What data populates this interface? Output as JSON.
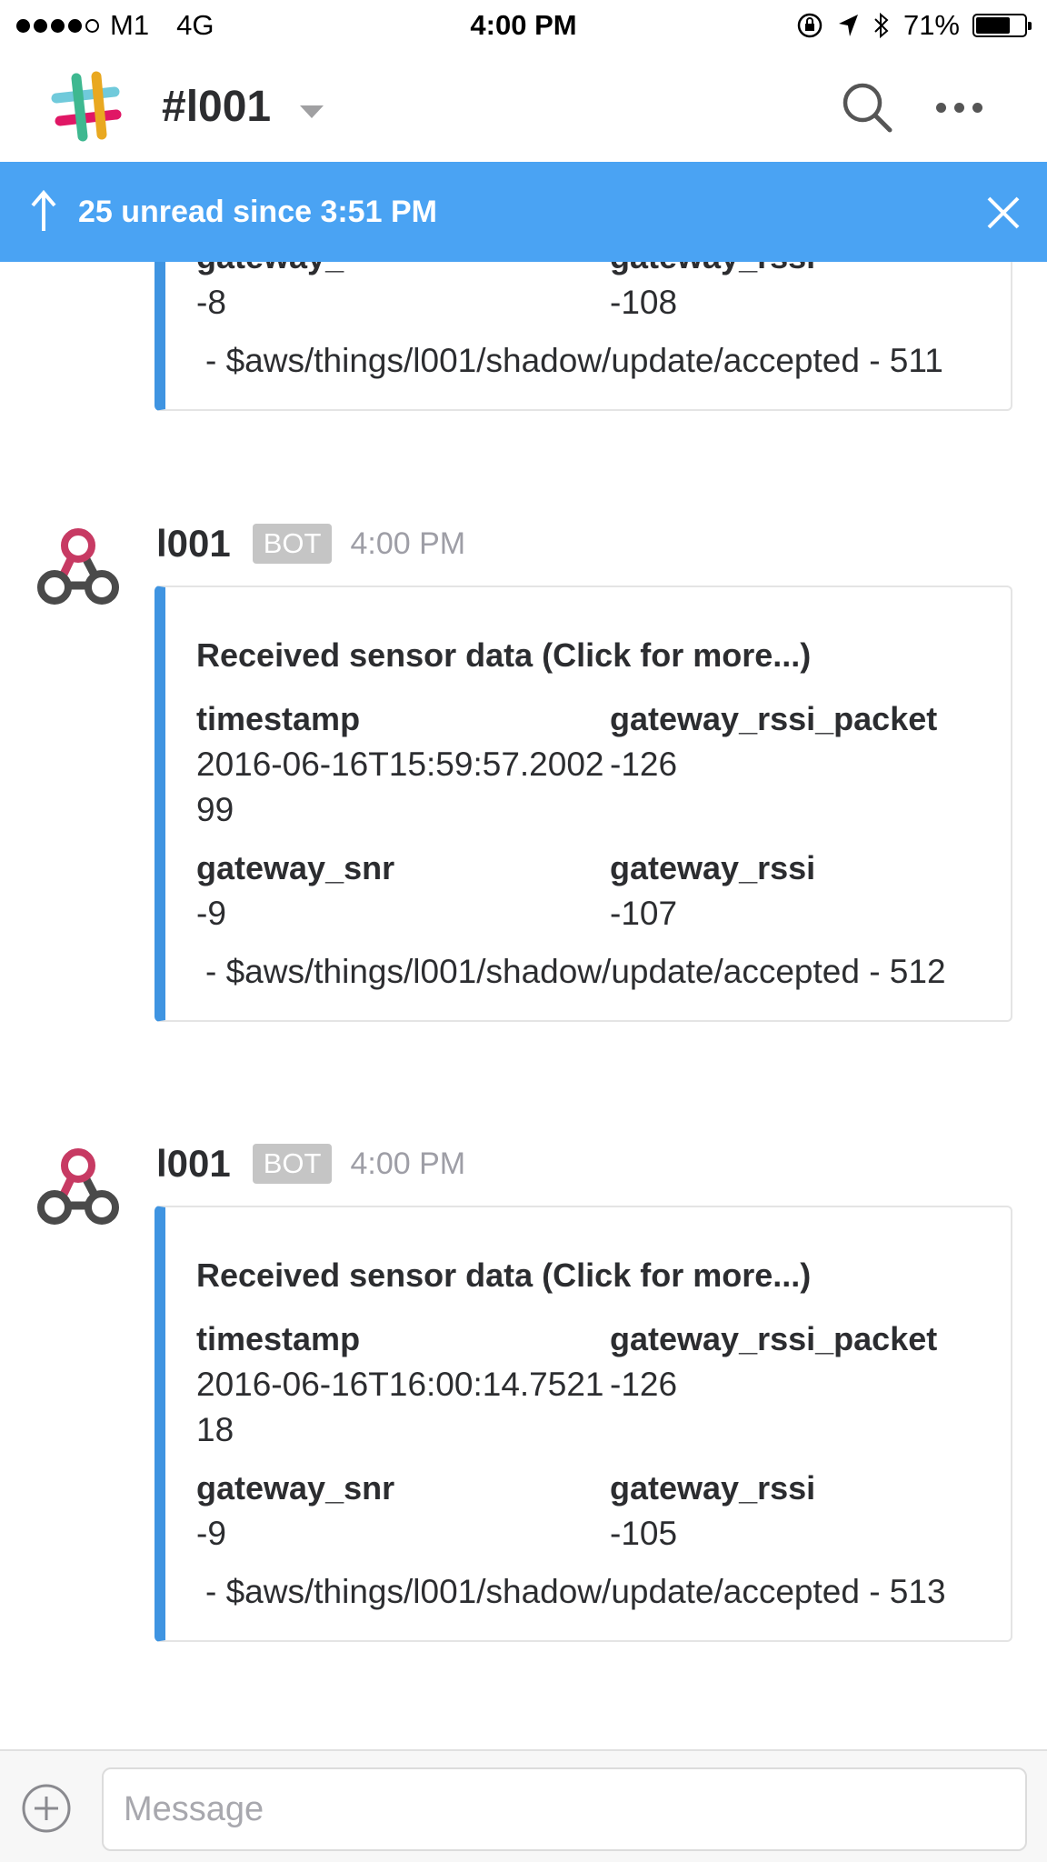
{
  "status_bar": {
    "carrier": "M1",
    "network": "4G",
    "time": "4:00 PM",
    "battery": "71%",
    "battery_level": 0.71
  },
  "header": {
    "channel": "#l001"
  },
  "banner": {
    "text": "25 unread since 3:51 PM"
  },
  "partial_attachment": {
    "label_left": "gateway_",
    "label_right": "gateway_rssi",
    "value_left": "-8",
    "value_right": "-108",
    "footer": "- $aws/things/l001/shadow/update/accepted - 511"
  },
  "messages": [
    {
      "user": "l001",
      "badge": "BOT",
      "time": "4:00 PM",
      "title": "Received sensor data (Click for more...)",
      "fields": [
        {
          "label": "timestamp",
          "value": "2016-06-16T15:59:57.200299"
        },
        {
          "label": "gateway_rssi_packet",
          "value": "-126"
        },
        {
          "label": "gateway_snr",
          "value": "-9"
        },
        {
          "label": "gateway_rssi",
          "value": "-107"
        }
      ],
      "footer": "- $aws/things/l001/shadow/update/accepted - 512"
    },
    {
      "user": "l001",
      "badge": "BOT",
      "time": "4:00 PM",
      "title": "Received sensor data (Click for more...)",
      "fields": [
        {
          "label": "timestamp",
          "value": "2016-06-16T16:00:14.752118"
        },
        {
          "label": "gateway_rssi_packet",
          "value": "-126"
        },
        {
          "label": "gateway_snr",
          "value": "-9"
        },
        {
          "label": "gateway_rssi",
          "value": "-105"
        }
      ],
      "footer": "- $aws/things/l001/shadow/update/accepted - 513"
    }
  ],
  "composer": {
    "placeholder": "Message"
  },
  "colors": {
    "banner": "#4aa3f3",
    "attachment_bar": "#3f94e1",
    "avatar_pink": "#c73a63"
  }
}
